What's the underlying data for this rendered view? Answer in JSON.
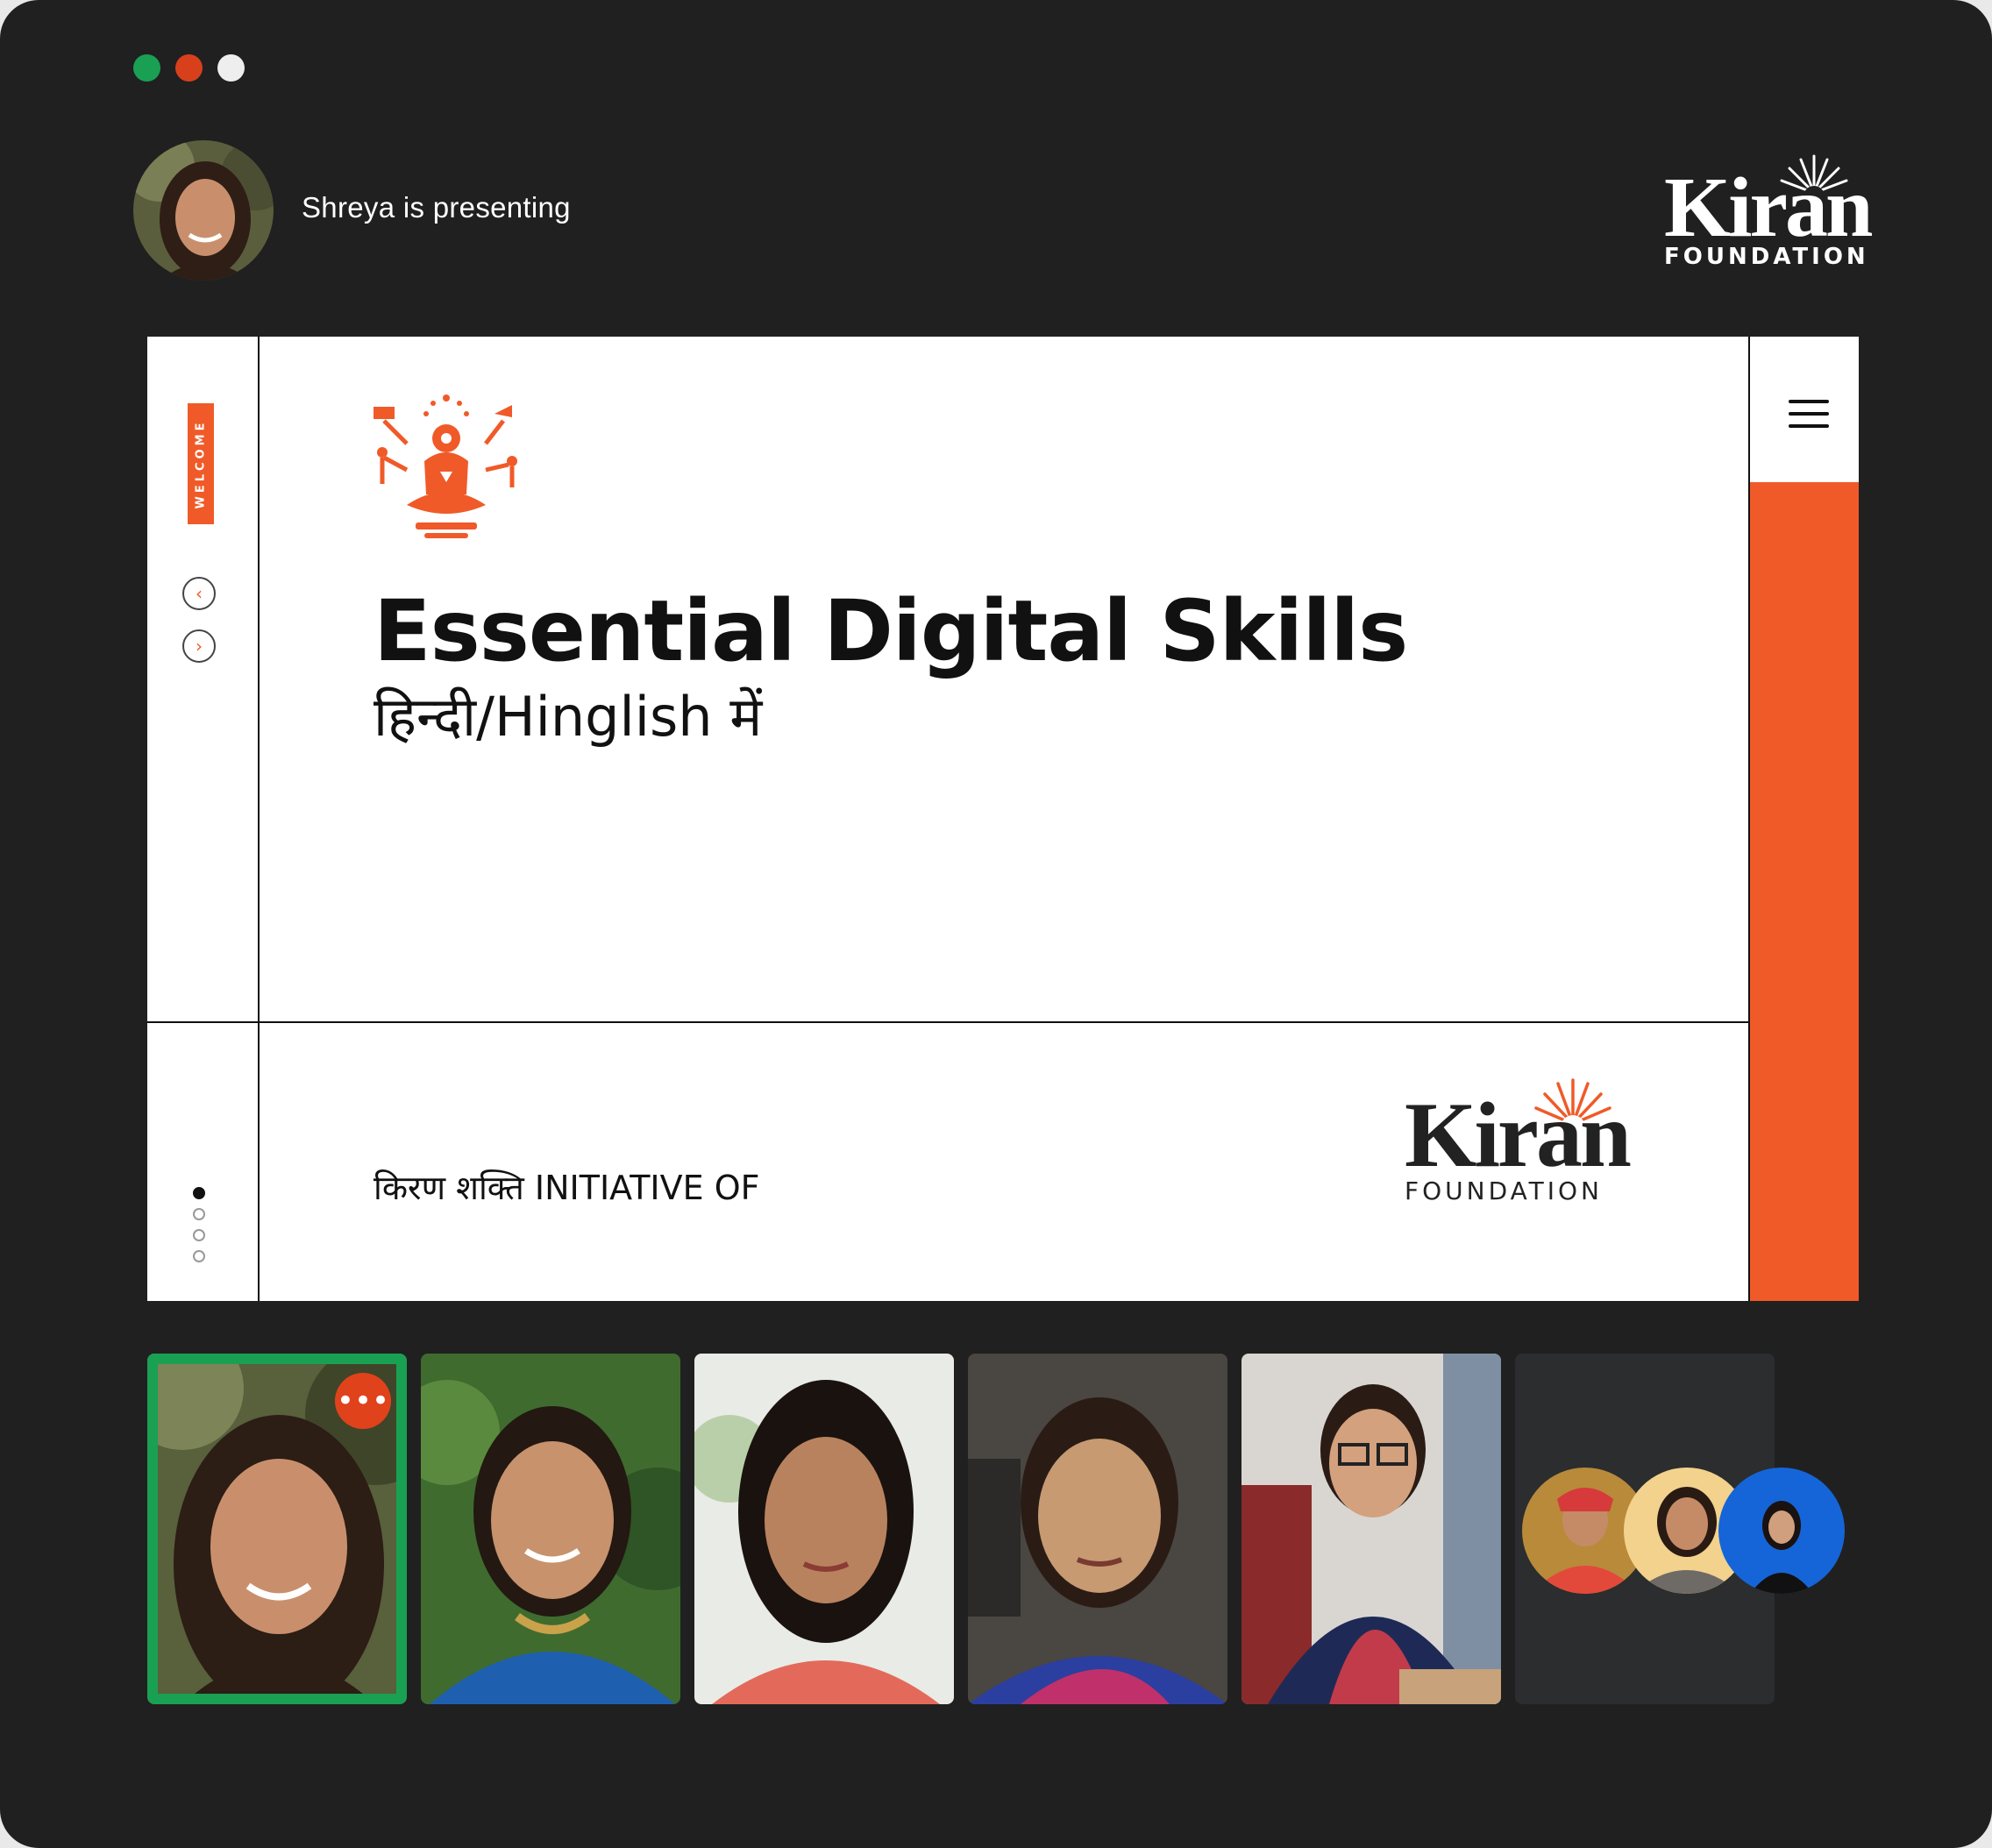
{
  "window": {
    "controls": [
      {
        "name": "close",
        "color": "#1aa053"
      },
      {
        "name": "minimize",
        "color": "#d8401c"
      },
      {
        "name": "maximize",
        "color": "#eeeeee"
      }
    ]
  },
  "header": {
    "presenter_text": "Shreya is presenting",
    "brand_word": "Kiran",
    "brand_sub": "FOUNDATION"
  },
  "slide": {
    "welcome_label": "WELCOME",
    "title": "Essential Digital Skills",
    "subtitle": "हिन्दी/Hinglish में",
    "initiative": "किरण शक्ति INITIATIVE OF",
    "brand_word": "Kiran",
    "brand_sub": "FOUNDATION",
    "accent": "#f05a28",
    "prev_icon": "chevron-left-icon",
    "next_icon": "chevron-right-icon",
    "menu_icon": "hamburger-menu-icon",
    "current_page": 1,
    "total_pages": 4
  },
  "participants": {
    "more_label": "•••",
    "speaking_color": "#1aa053",
    "count_visible_tiles": 5,
    "overflow_avatars": 3
  }
}
